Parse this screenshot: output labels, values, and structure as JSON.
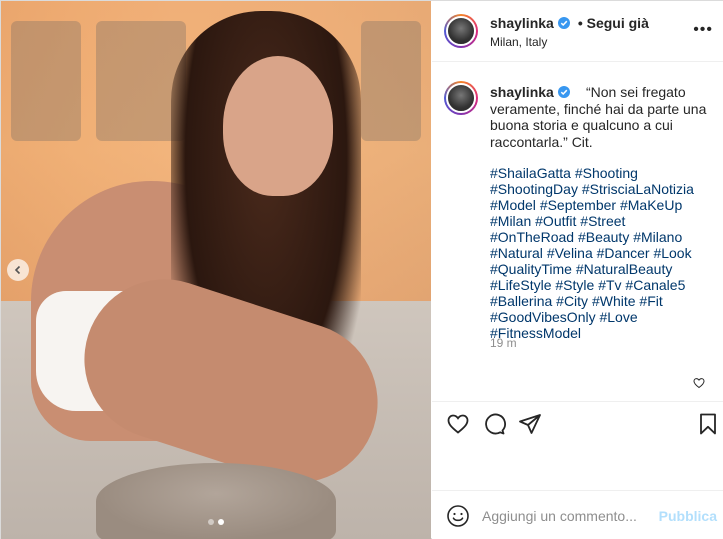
{
  "post": {
    "username": "shaylinka",
    "follow_status": "• Segui già",
    "location": "Milan, Italy",
    "more_icon": "ellipsis-icon"
  },
  "caption": {
    "username": "shaylinka",
    "text": "“Non sei fregato veramente, finché hai da parte una buona storia e qualcuno a cui raccontarla.” Cit.",
    "hashtags": [
      "#ShailaGatta",
      "#Shooting",
      "#ShootingDay",
      "#StrisciaLaNotizia",
      "#Model",
      "#September",
      "#MaKeUp",
      "#Milan",
      "#Outfit",
      "#Street",
      "#OnTheRoad",
      "#Beauty",
      "#Milano",
      "#Natural",
      "#Velina",
      "#Dancer",
      "#Look",
      "#QualityTime",
      "#NaturalBeauty",
      "#LifeStyle",
      "#Style",
      "#Tv",
      "#Canale5",
      "#Ballerina",
      "#City",
      "#White",
      "#Fit",
      "#GoodVibesOnly",
      "#Love",
      "#FitnessModel"
    ],
    "time_ago": "19 m"
  },
  "carousel": {
    "dot_count": 2,
    "active_index": 1
  },
  "comment_box": {
    "placeholder": "Aggiungi un commento...",
    "publish_label": "Pubblica"
  },
  "colors": {
    "link": "#00376b",
    "verified": "#3897f0",
    "publish_disabled": "#b2dffc",
    "muted": "#8e8e8e"
  }
}
